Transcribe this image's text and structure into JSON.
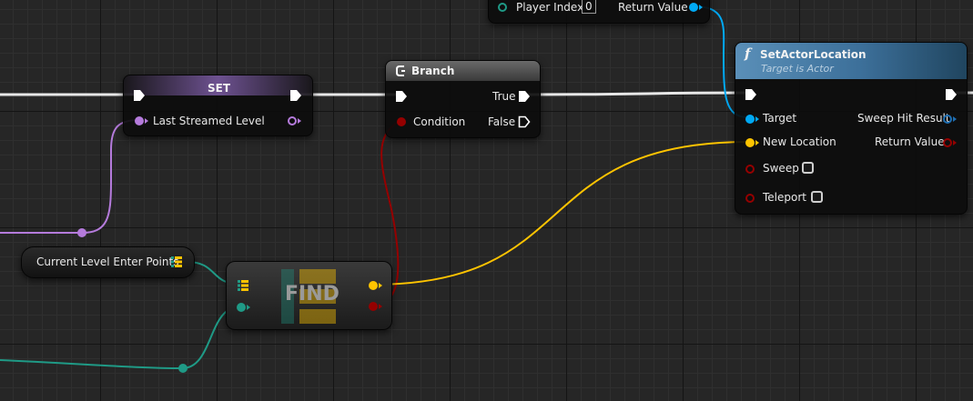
{
  "get_player_pawn": {
    "player_index_label": "Player Index",
    "player_index_value": "0",
    "return_value_label": "Return Value"
  },
  "set_node": {
    "title": "SET",
    "var_label": "Last Streamed Level"
  },
  "branch_node": {
    "title": "Branch",
    "true_label": "True",
    "condition_label": "Condition",
    "false_label": "False"
  },
  "set_actor_location": {
    "icon": "f",
    "title": "SetActorLocation",
    "subtitle": "Target is Actor",
    "target_label": "Target",
    "sweep_hit_result_label": "Sweep Hit Result",
    "new_location_label": "New Location",
    "return_value_label": "Return Value",
    "sweep_label": "Sweep",
    "teleport_label": "Teleport"
  },
  "variable_node": {
    "label": "Current Level Enter Points"
  },
  "find_node": {
    "title": "FIND"
  },
  "colors": {
    "exec": "#ffffff",
    "object": "#00a9f4",
    "struct_vector": "#ffc400",
    "boolean": "#950000",
    "level_ref": "#b57bdc",
    "integer": "#1f9a86"
  }
}
